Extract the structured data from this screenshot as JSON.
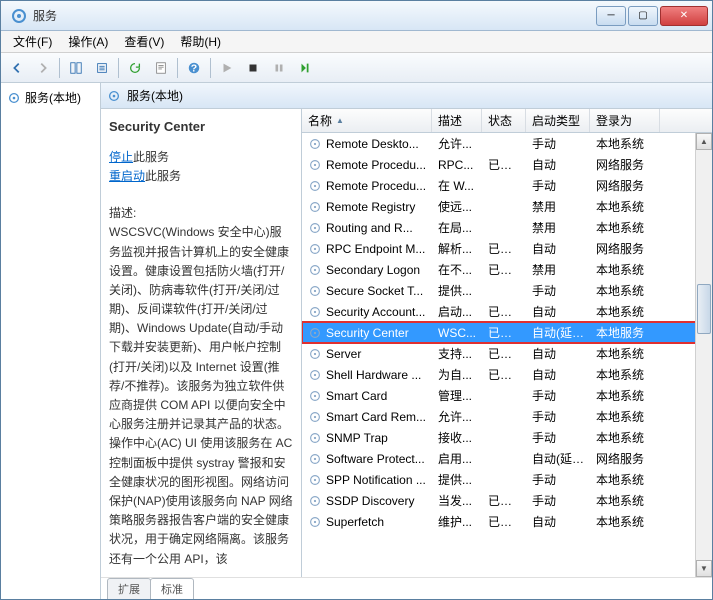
{
  "window": {
    "title": "服务"
  },
  "menu": {
    "file": "文件(F)",
    "action": "操作(A)",
    "view": "查看(V)",
    "help": "帮助(H)"
  },
  "tree": {
    "root": "服务(本地)"
  },
  "right_header": "服务(本地)",
  "detail": {
    "title": "Security Center",
    "stop_link": "停止",
    "stop_suffix": "此服务",
    "restart_link": "重启动",
    "restart_suffix": "此服务",
    "desc_label": "描述:",
    "description": "WSCSVC(Windows 安全中心)服务监视并报告计算机上的安全健康设置。健康设置包括防火墙(打开/关闭)、防病毒软件(打开/关闭/过期)、反间谍软件(打开/关闭/过期)、Windows Update(自动/手动下载并安装更新)、用户帐户控制(打开/关闭)以及 Internet 设置(推荐/不推荐)。该服务为独立软件供应商提供 COM API 以便向安全中心服务注册并记录其产品的状态。操作中心(AC) UI 使用该服务在 AC 控制面板中提供 systray 警报和安全健康状况的图形视图。网络访问保护(NAP)使用该服务向 NAP 网络策略服务器报告客户端的安全健康状况，用于确定网络隔离。该服务还有一个公用 API，该"
  },
  "columns": {
    "name": "名称",
    "desc": "描述",
    "status": "状态",
    "startup": "启动类型",
    "logon": "登录为"
  },
  "rows": [
    {
      "name": "Remote Deskto...",
      "desc": "允许...",
      "status": "",
      "startup": "手动",
      "logon": "本地系统"
    },
    {
      "name": "Remote Procedu...",
      "desc": "RPC...",
      "status": "已启动",
      "startup": "自动",
      "logon": "网络服务"
    },
    {
      "name": "Remote Procedu...",
      "desc": "在 W...",
      "status": "",
      "startup": "手动",
      "logon": "网络服务"
    },
    {
      "name": "Remote Registry",
      "desc": "使远...",
      "status": "",
      "startup": "禁用",
      "logon": "本地系统"
    },
    {
      "name": "Routing and R...",
      "desc": "在局...",
      "status": "",
      "startup": "禁用",
      "logon": "本地系统"
    },
    {
      "name": "RPC Endpoint M...",
      "desc": "解析...",
      "status": "已启动",
      "startup": "自动",
      "logon": "网络服务"
    },
    {
      "name": "Secondary Logon",
      "desc": "在不...",
      "status": "已启动",
      "startup": "禁用",
      "logon": "本地系统"
    },
    {
      "name": "Secure Socket T...",
      "desc": "提供...",
      "status": "",
      "startup": "手动",
      "logon": "本地系统"
    },
    {
      "name": "Security Account...",
      "desc": "启动...",
      "status": "已启动",
      "startup": "自动",
      "logon": "本地系统"
    },
    {
      "name": "Security Center",
      "desc": "WSC...",
      "status": "已启动",
      "startup": "自动(延迟...",
      "logon": "本地服务",
      "selected": true,
      "highlighted": true
    },
    {
      "name": "Server",
      "desc": "支持...",
      "status": "已启动",
      "startup": "自动",
      "logon": "本地系统"
    },
    {
      "name": "Shell Hardware ...",
      "desc": "为自...",
      "status": "已启动",
      "startup": "自动",
      "logon": "本地系统"
    },
    {
      "name": "Smart Card",
      "desc": "管理...",
      "status": "",
      "startup": "手动",
      "logon": "本地系统"
    },
    {
      "name": "Smart Card Rem...",
      "desc": "允许...",
      "status": "",
      "startup": "手动",
      "logon": "本地系统"
    },
    {
      "name": "SNMP Trap",
      "desc": "接收...",
      "status": "",
      "startup": "手动",
      "logon": "本地系统"
    },
    {
      "name": "Software Protect...",
      "desc": "启用...",
      "status": "",
      "startup": "自动(延迟...",
      "logon": "网络服务"
    },
    {
      "name": "SPP Notification ...",
      "desc": "提供...",
      "status": "",
      "startup": "手动",
      "logon": "本地系统"
    },
    {
      "name": "SSDP Discovery",
      "desc": "当发...",
      "status": "已启动",
      "startup": "手动",
      "logon": "本地系统"
    },
    {
      "name": "Superfetch",
      "desc": "维护...",
      "status": "已启动",
      "startup": "自动",
      "logon": "本地系统"
    }
  ],
  "tabs": {
    "extended": "扩展",
    "standard": "标准"
  }
}
